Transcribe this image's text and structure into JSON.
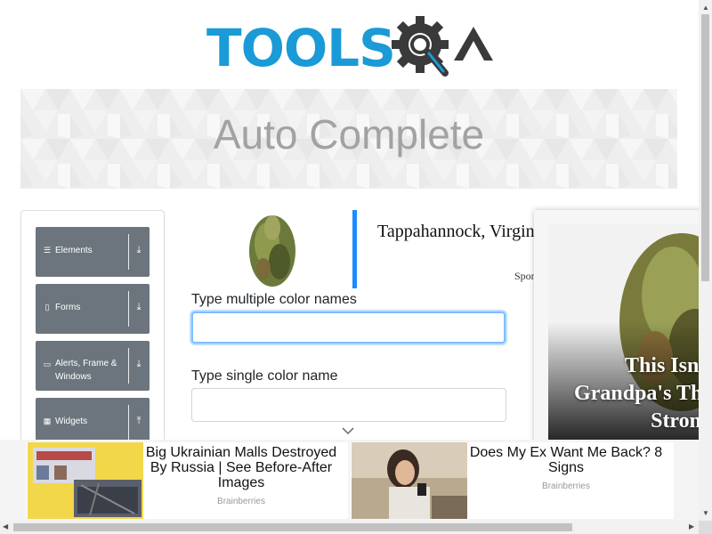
{
  "logo": {
    "text": "TOOLS",
    "suffix": "QA"
  },
  "banner": {
    "title": "Auto Complete"
  },
  "sidebar": {
    "groups": [
      {
        "label": "Elements",
        "icon": "hamburger-icon",
        "state": "collapsed"
      },
      {
        "label": "Forms",
        "icon": "form-icon",
        "state": "collapsed"
      },
      {
        "label": "Alerts, Frame & Windows",
        "icon": "window-icon",
        "state": "collapsed"
      },
      {
        "label": "Widgets",
        "icon": "grid-icon",
        "state": "expanded"
      }
    ]
  },
  "ad_top": {
    "headline": "Tappahannock, Virgin",
    "sponsored": "Spon"
  },
  "form": {
    "multiple_label": "Type multiple color names",
    "multiple_value": "",
    "single_label": "Type single color name",
    "single_value": ""
  },
  "side_ad": {
    "lines": [
      "This Isn't",
      "Grandpa's The",
      "Strong"
    ]
  },
  "bottom_ad": {
    "cards": [
      {
        "title": "Big Ukrainian Malls Destroyed By Russia | See Before-After Images",
        "source": "Brainberries"
      },
      {
        "title": "Does My Ex Want Me Back? 8 Signs",
        "source": "Brainberries"
      }
    ]
  },
  "colors": {
    "brand_blue": "#1a9ad6",
    "brand_dark": "#3a3a3a",
    "sidebar_group": "#6c757d",
    "ad_accent": "#1a8cff"
  }
}
